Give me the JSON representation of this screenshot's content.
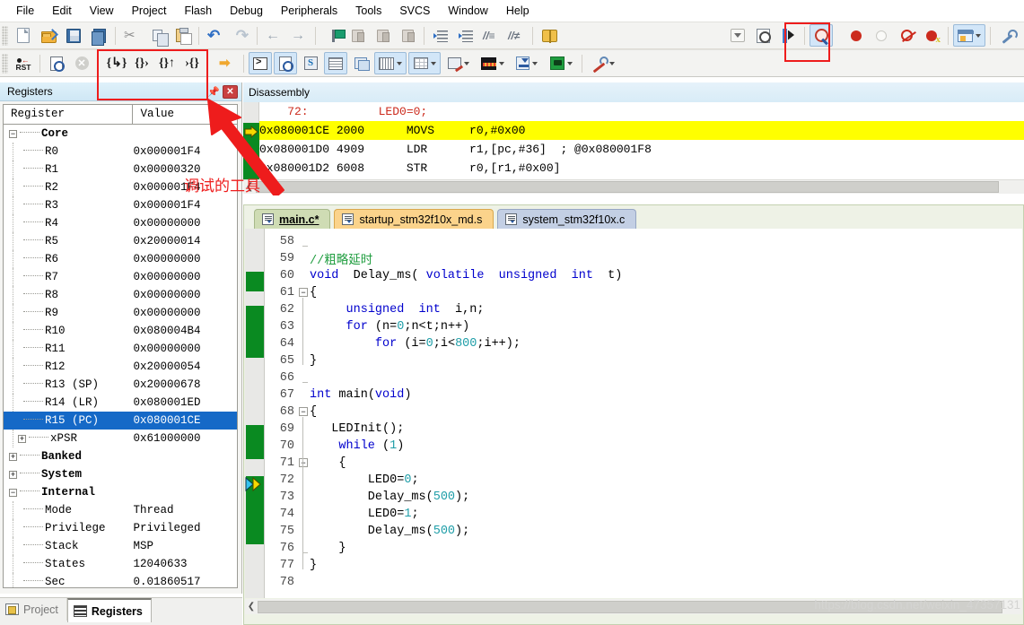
{
  "menu": {
    "items": [
      "File",
      "Edit",
      "View",
      "Project",
      "Flash",
      "Debug",
      "Peripherals",
      "Tools",
      "SVCS",
      "Window",
      "Help"
    ]
  },
  "toolbar_row1": {
    "buttons": [
      {
        "name": "new-file-button",
        "icon": "new-file-icon"
      },
      {
        "name": "open-file-button",
        "icon": "open-folder-icon"
      },
      {
        "name": "save-button",
        "icon": "save-disk-icon"
      },
      {
        "name": "save-all-button",
        "icon": "save-all-icon"
      },
      {
        "name": "cut-button",
        "icon": "scissors-icon"
      },
      {
        "name": "copy-button",
        "icon": "copy-icon"
      },
      {
        "name": "paste-button",
        "icon": "paste-icon"
      },
      {
        "name": "undo-button",
        "icon": "undo-arrow-icon"
      },
      {
        "name": "redo-button",
        "icon": "redo-arrow-icon"
      },
      {
        "name": "navigate-back-button",
        "icon": "arrow-left-icon"
      },
      {
        "name": "navigate-forward-button",
        "icon": "arrow-right-icon"
      },
      {
        "name": "toggle-bookmark-button",
        "icon": "flag-icon"
      },
      {
        "name": "previous-bookmark-button",
        "icon": "bookmark-prev-icon"
      },
      {
        "name": "next-bookmark-button",
        "icon": "bookmark-next-icon"
      },
      {
        "name": "clear-bookmarks-button",
        "icon": "bookmark-clear-icon"
      },
      {
        "name": "indent-right-button",
        "icon": "indent-right-icon"
      },
      {
        "name": "indent-left-button",
        "icon": "indent-left-icon"
      },
      {
        "name": "comment-button",
        "icon": "comment-lines-icon"
      },
      {
        "name": "uncomment-button",
        "icon": "uncomment-lines-icon"
      },
      {
        "name": "configure-button",
        "icon": "book-open-icon"
      }
    ],
    "right_buttons": [
      {
        "name": "target-select-dropdown",
        "icon": "chevron-down-icon"
      },
      {
        "name": "target-options-button",
        "icon": "target-options-icon"
      },
      {
        "name": "build-target-button",
        "icon": "magic-wand-icon"
      },
      {
        "name": "start-stop-debug-button",
        "icon": "debug-magnifier-icon"
      },
      {
        "name": "insert-breakpoint-button",
        "icon": "breakpoint-red-dot-icon"
      },
      {
        "name": "kill-all-breakpoints-button",
        "icon": "breakpoint-empty-icon"
      },
      {
        "name": "disable-breakpoint-button",
        "icon": "breakpoint-disabled-icon"
      },
      {
        "name": "disable-all-breakpoints-button",
        "icon": "breakpoint-kill-icon"
      },
      {
        "name": "window-layout-button",
        "icon": "window-layout-icon"
      },
      {
        "name": "configure-tools-button",
        "icon": "wrench-icon"
      }
    ]
  },
  "toolbar_row2": {
    "buttons": [
      {
        "name": "reset-cpu-button",
        "icon": "reset-rst-icon"
      },
      {
        "name": "run-button",
        "icon": "run-to-main-icon"
      },
      {
        "name": "stop-button",
        "icon": "stop-circle-icon"
      },
      {
        "name": "step-button",
        "icon": "step-into-icon",
        "glyph": "{↷}"
      },
      {
        "name": "step-over-button",
        "icon": "step-over-icon",
        "glyph": "{}→"
      },
      {
        "name": "step-out-button",
        "icon": "step-out-icon",
        "glyph": "{↱}"
      },
      {
        "name": "run-to-cursor-button",
        "icon": "run-to-cursor-icon",
        "glyph": "→{}"
      },
      {
        "name": "show-next-statement-button",
        "icon": "yellow-arrow-icon"
      },
      {
        "name": "command-window-button",
        "icon": "command-prompt-icon"
      },
      {
        "name": "disassembly-window-button",
        "icon": "disassembly-icon"
      },
      {
        "name": "symbols-window-button",
        "icon": "symbols-icon"
      },
      {
        "name": "registers-window-button",
        "icon": "registers-grid-icon"
      },
      {
        "name": "call-stack-window-button",
        "icon": "call-stack-icon"
      },
      {
        "name": "watch-windows-button",
        "icon": "watch-window-icon"
      },
      {
        "name": "memory-windows-button",
        "icon": "memory-window-icon"
      },
      {
        "name": "serial-windows-button",
        "icon": "serial-window-icon"
      },
      {
        "name": "analysis-windows-button",
        "icon": "logic-analyzer-icon"
      },
      {
        "name": "trace-windows-button",
        "icon": "trace-window-icon"
      },
      {
        "name": "system-viewer-button",
        "icon": "system-viewer-icon"
      },
      {
        "name": "toolbox-button",
        "icon": "toolbox-icon"
      }
    ]
  },
  "annotations": {
    "debug_tools_label": "调试的工具",
    "highlight_color": "#ee1c1c"
  },
  "registers_panel": {
    "title": "Registers",
    "pin_icon": "pin-icon",
    "close_icon": "close-icon",
    "columns": [
      "Register",
      "Value"
    ],
    "groups": [
      {
        "name": "Core",
        "expanded": true,
        "rows": [
          {
            "name": "R0",
            "value": "0x000001F4"
          },
          {
            "name": "R1",
            "value": "0x00000320"
          },
          {
            "name": "R2",
            "value": "0x000001F4"
          },
          {
            "name": "R3",
            "value": "0x000001F4"
          },
          {
            "name": "R4",
            "value": "0x00000000"
          },
          {
            "name": "R5",
            "value": "0x20000014"
          },
          {
            "name": "R6",
            "value": "0x00000000"
          },
          {
            "name": "R7",
            "value": "0x00000000"
          },
          {
            "name": "R8",
            "value": "0x00000000"
          },
          {
            "name": "R9",
            "value": "0x00000000"
          },
          {
            "name": "R10",
            "value": "0x080004B4"
          },
          {
            "name": "R11",
            "value": "0x00000000"
          },
          {
            "name": "R12",
            "value": "0x20000054"
          },
          {
            "name": "R13 (SP)",
            "value": "0x20000678"
          },
          {
            "name": "R14 (LR)",
            "value": "0x080001ED"
          },
          {
            "name": "R15 (PC)",
            "value": "0x080001CE",
            "selected": true
          },
          {
            "name": "xPSR",
            "value": "0x61000000",
            "expandable": true
          }
        ]
      },
      {
        "name": "Banked",
        "expanded": false,
        "rows": []
      },
      {
        "name": "System",
        "expanded": false,
        "rows": []
      },
      {
        "name": "Internal",
        "expanded": true,
        "rows": [
          {
            "name": "Mode",
            "value": "Thread"
          },
          {
            "name": "Privilege",
            "value": "Privileged"
          },
          {
            "name": "Stack",
            "value": "MSP"
          },
          {
            "name": "States",
            "value": "12040633"
          },
          {
            "name": "Sec",
            "value": "0.01860517"
          }
        ]
      }
    ],
    "bottom_tabs": [
      {
        "label": "Project",
        "icon": "project-icon",
        "active": false
      },
      {
        "label": "Registers",
        "icon": "registers-icon",
        "active": true
      }
    ]
  },
  "disassembly": {
    "title": "Disassembly",
    "lines": [
      {
        "type": "source",
        "text": "    72:          LED0=0;"
      },
      {
        "type": "asm",
        "current": true,
        "text": "0x080001CE 2000      MOVS     r0,#0x00"
      },
      {
        "type": "asm",
        "text": "0x080001D0 4909      LDR      r1,[pc,#36]  ; @0x080001F8"
      },
      {
        "type": "asm",
        "text": "0x080001D2 6008      STR      r0,[r1,#0x00]"
      }
    ]
  },
  "editor": {
    "tabs": [
      {
        "label": "main.c*",
        "active": true,
        "color": "green"
      },
      {
        "label": "startup_stm32f10x_md.s",
        "active": false,
        "color": "orange"
      },
      {
        "label": "system_stm32f10x.c",
        "active": false,
        "color": "blue"
      }
    ],
    "lines": [
      {
        "n": 58,
        "tokens": [],
        "fold": "end"
      },
      {
        "n": 59,
        "tokens": [
          {
            "t": "//粗略延时",
            "c": "cmt2"
          }
        ]
      },
      {
        "n": 60,
        "tokens": [
          {
            "t": "void",
            "c": "kw"
          },
          {
            "t": "  Delay_ms( ",
            "c": "plain"
          },
          {
            "t": "volatile",
            "c": "kw"
          },
          {
            "t": "  ",
            "c": "plain"
          },
          {
            "t": "unsigned",
            "c": "kw"
          },
          {
            "t": "  ",
            "c": "plain"
          },
          {
            "t": "int",
            "c": "kw"
          },
          {
            "t": "  t)",
            "c": "plain"
          }
        ]
      },
      {
        "n": 61,
        "tokens": [
          {
            "t": "{",
            "c": "plain"
          }
        ],
        "fold": "open"
      },
      {
        "n": 62,
        "tokens": [
          {
            "t": "     ",
            "c": "plain"
          },
          {
            "t": "unsigned",
            "c": "kw"
          },
          {
            "t": "  ",
            "c": "plain"
          },
          {
            "t": "int",
            "c": "kw"
          },
          {
            "t": "  i,n;",
            "c": "plain"
          }
        ]
      },
      {
        "n": 63,
        "tokens": [
          {
            "t": "     ",
            "c": "plain"
          },
          {
            "t": "for",
            "c": "kw"
          },
          {
            "t": " (n=",
            "c": "plain"
          },
          {
            "t": "0",
            "c": "num"
          },
          {
            "t": ";n<t;n++)",
            "c": "plain"
          }
        ]
      },
      {
        "n": 64,
        "tokens": [
          {
            "t": "         ",
            "c": "plain"
          },
          {
            "t": "for",
            "c": "kw"
          },
          {
            "t": " (i=",
            "c": "plain"
          },
          {
            "t": "0",
            "c": "num"
          },
          {
            "t": ";i<",
            "c": "plain"
          },
          {
            "t": "800",
            "c": "num"
          },
          {
            "t": ";i++);",
            "c": "plain"
          }
        ]
      },
      {
        "n": 65,
        "tokens": [
          {
            "t": "}",
            "c": "plain"
          }
        ]
      },
      {
        "n": 66,
        "tokens": [],
        "fold": "end"
      },
      {
        "n": 67,
        "tokens": [
          {
            "t": "int",
            "c": "kw"
          },
          {
            "t": " main(",
            "c": "plain"
          },
          {
            "t": "void",
            "c": "kw"
          },
          {
            "t": ")",
            "c": "plain"
          }
        ]
      },
      {
        "n": 68,
        "tokens": [
          {
            "t": "{",
            "c": "plain"
          }
        ],
        "fold": "open"
      },
      {
        "n": 69,
        "tokens": [
          {
            "t": "   LEDInit();",
            "c": "plain"
          }
        ]
      },
      {
        "n": 70,
        "tokens": [
          {
            "t": "    ",
            "c": "plain"
          },
          {
            "t": "while",
            "c": "kw"
          },
          {
            "t": " (",
            "c": "plain"
          },
          {
            "t": "1",
            "c": "num"
          },
          {
            "t": ")",
            "c": "plain"
          }
        ]
      },
      {
        "n": 71,
        "tokens": [
          {
            "t": "    {",
            "c": "plain"
          }
        ],
        "fold": "open"
      },
      {
        "n": 72,
        "tokens": [
          {
            "t": "        LED0=",
            "c": "plain"
          },
          {
            "t": "0",
            "c": "num"
          },
          {
            "t": ";",
            "c": "plain"
          }
        ],
        "current": true
      },
      {
        "n": 73,
        "tokens": [
          {
            "t": "        Delay_ms(",
            "c": "plain"
          },
          {
            "t": "500",
            "c": "num"
          },
          {
            "t": ");",
            "c": "plain"
          }
        ]
      },
      {
        "n": 74,
        "tokens": [
          {
            "t": "        LED0=",
            "c": "plain"
          },
          {
            "t": "1",
            "c": "num"
          },
          {
            "t": ";",
            "c": "plain"
          }
        ]
      },
      {
        "n": 75,
        "tokens": [
          {
            "t": "        Delay_ms(",
            "c": "plain"
          },
          {
            "t": "500",
            "c": "num"
          },
          {
            "t": ");",
            "c": "plain"
          }
        ]
      },
      {
        "n": 76,
        "tokens": [
          {
            "t": "    }",
            "c": "plain"
          }
        ],
        "fold": "end"
      },
      {
        "n": 77,
        "tokens": [
          {
            "t": "}",
            "c": "plain"
          }
        ]
      },
      {
        "n": 78,
        "tokens": []
      }
    ]
  },
  "watermark": {
    "text": "https://blog.csdn.net/weixin_47357131"
  }
}
